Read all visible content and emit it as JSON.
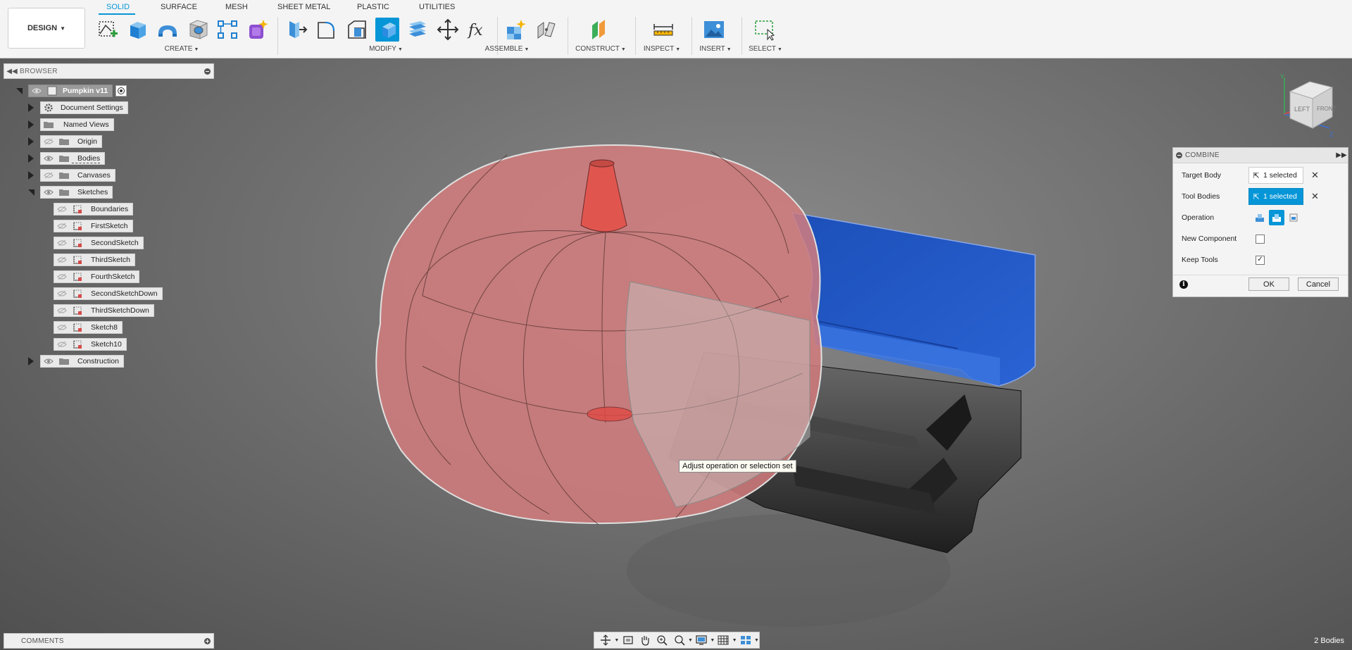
{
  "app": {
    "workspace_label": "DESIGN",
    "tabs": [
      {
        "label": "SOLID",
        "active": true
      },
      {
        "label": "SURFACE",
        "active": false
      },
      {
        "label": "MESH",
        "active": false
      },
      {
        "label": "SHEET METAL",
        "active": false
      },
      {
        "label": "PLASTIC",
        "active": false
      },
      {
        "label": "UTILITIES",
        "active": false
      }
    ],
    "groups": {
      "create": "CREATE",
      "modify": "MODIFY",
      "assemble": "ASSEMBLE",
      "construct": "CONSTRUCT",
      "inspect": "INSPECT",
      "insert": "INSERT",
      "select": "SELECT"
    },
    "accent_color": "#0696d7"
  },
  "browser": {
    "title": "BROWSER",
    "root_label": "Pumpkin v11",
    "items": {
      "document_settings": "Document Settings",
      "named_views": "Named Views",
      "origin": "Origin",
      "bodies": "Bodies",
      "canvases": "Canvases",
      "sketches": "Sketches",
      "construction": "Construction"
    },
    "sketches": [
      "Boundaries",
      "FirstSketch",
      "SecondSketch",
      "ThirdSketch",
      "FourthSketch",
      "SecondSketchDown",
      "ThirdSketchDown",
      "Sketch8",
      "Sketch10"
    ]
  },
  "viewport": {
    "tooltip": "Adjust operation or selection set",
    "pumpkin_color": "#d98a8a",
    "tool_body_color": "#1f56c4",
    "viewcube_face": "LEFT",
    "viewcube_face_2": "FRONT",
    "axis_y": "Y",
    "axis_z": "Z",
    "status_bodies": "2 Bodies"
  },
  "combine": {
    "title": "COMBINE",
    "target_body_label": "Target Body",
    "target_body_value": "1 selected",
    "tool_bodies_label": "Tool Bodies",
    "tool_bodies_value": "1 selected",
    "operation_label": "Operation",
    "new_component_label": "New Component",
    "new_component_checked": false,
    "keep_tools_label": "Keep Tools",
    "keep_tools_checked": true,
    "ok_label": "OK",
    "cancel_label": "Cancel"
  },
  "comments": {
    "title": "COMMENTS"
  }
}
